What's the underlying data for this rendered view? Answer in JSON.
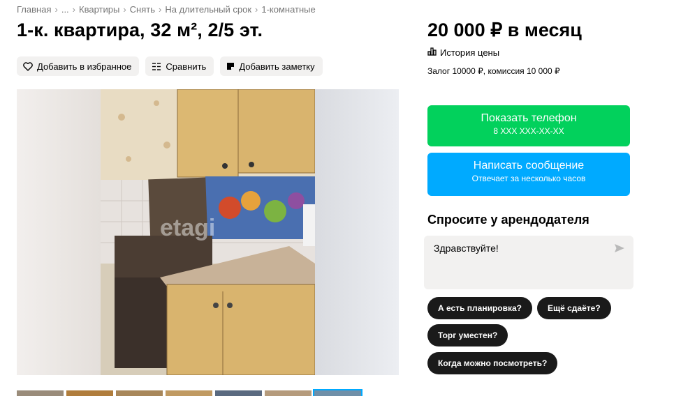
{
  "breadcrumbs": [
    "Главная",
    "...",
    "Квартиры",
    "Снять",
    "На длительный срок",
    "1-комнатные"
  ],
  "breadcrumb_separator": "›",
  "listing": {
    "title": "1-к. квартира, 32 м², 2/5 эт.",
    "price": "20 000 ₽ в месяц",
    "price_history_label": "История цены",
    "deposit_text": "Залог 10000 ₽, комиссия 10 000 ₽"
  },
  "actions": {
    "favorite": "Добавить в избранное",
    "compare": "Сравнить",
    "note": "Добавить заметку"
  },
  "contact": {
    "phone_label": "Показать телефон",
    "phone_masked": "8 XXX XXX-XX-XX",
    "message_label": "Написать сообщение",
    "message_sub": "Отвечает за несколько часов"
  },
  "ask": {
    "title": "Спросите у арендодателя",
    "message_value": "Здравствуйте!",
    "quick_replies": [
      "А есть планировка?",
      "Ещё сдаёте?",
      "Торг уместен?",
      "Когда можно посмотреть?"
    ]
  },
  "gallery": {
    "watermark": "etagi",
    "thumbnail_count": 7
  },
  "colors": {
    "phone_button": "#02d15c",
    "message_button": "#00aaff",
    "chip": "#1a1a1a",
    "pill_bg": "#f2f1f0"
  }
}
